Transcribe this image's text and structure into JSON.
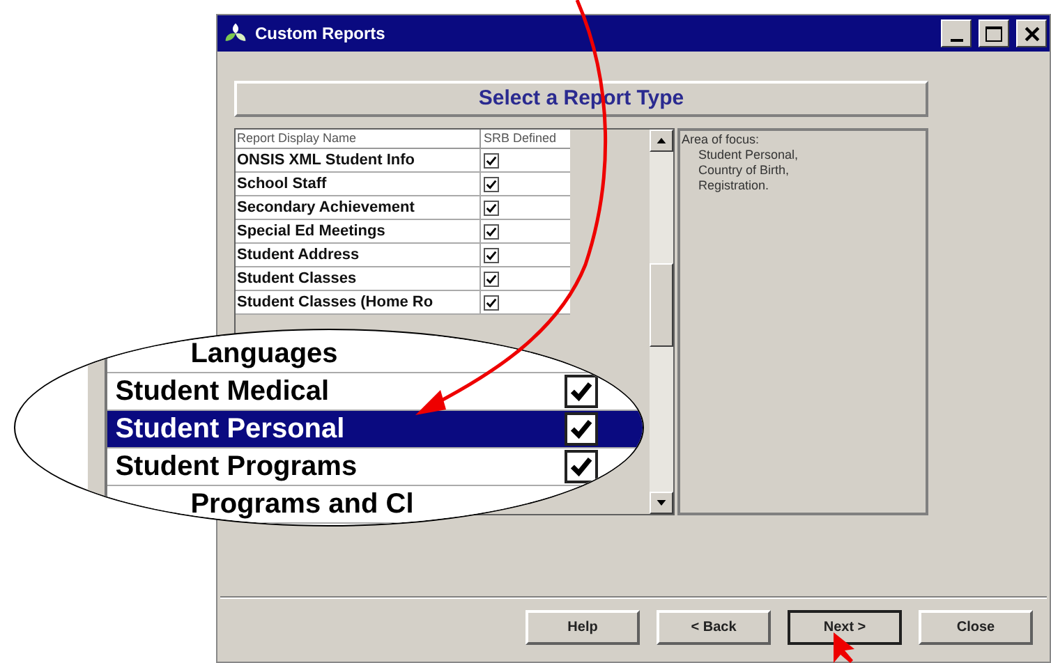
{
  "window": {
    "title": "Custom Reports"
  },
  "heading": "Select a Report Type",
  "list": {
    "columns": [
      "Report Display Name",
      "SRB Defined"
    ],
    "rows": [
      {
        "name": "ONSIS XML Student Info",
        "srb_defined": true
      },
      {
        "name": "School Staff",
        "srb_defined": true
      },
      {
        "name": "Secondary Achievement",
        "srb_defined": true
      },
      {
        "name": "Special Ed Meetings",
        "srb_defined": true
      },
      {
        "name": "Student Address",
        "srb_defined": true
      },
      {
        "name": "Student Classes",
        "srb_defined": true
      },
      {
        "name": "Student Classes (Home Ro",
        "srb_defined": true
      }
    ]
  },
  "magnifier": {
    "rows": [
      {
        "name": "Languages",
        "checked": false,
        "selected": false
      },
      {
        "name": "Student Medical",
        "checked": true,
        "selected": false
      },
      {
        "name": "Student Personal",
        "checked": true,
        "selected": true
      },
      {
        "name": "Student Programs",
        "checked": true,
        "selected": false
      },
      {
        "name": "Programs and Cl",
        "checked": false,
        "selected": false
      }
    ]
  },
  "details": {
    "lines": [
      "Area of focus:",
      "Student Personal,",
      "Country of Birth,",
      "Registration."
    ]
  },
  "buttons": [
    {
      "label": "Help",
      "default": false
    },
    {
      "label": "< Back",
      "default": false
    },
    {
      "label": "Next >",
      "default": true
    },
    {
      "label": "Close",
      "default": false
    }
  ]
}
